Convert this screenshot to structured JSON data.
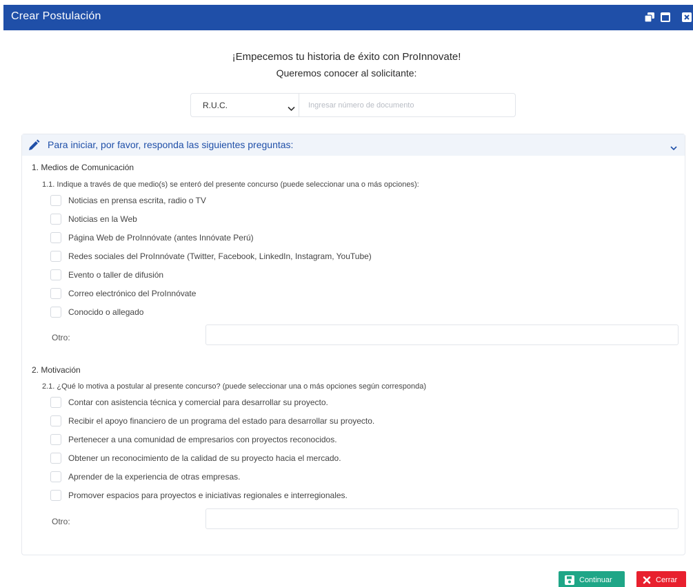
{
  "window": {
    "title": "Crear Postulación"
  },
  "intro": {
    "line1": "¡Empecemos tu historia de éxito con ProInnovate!",
    "line2": "Queremos conocer al solicitante:"
  },
  "document": {
    "type_selected": "R.U.C.",
    "number_value": "",
    "number_placeholder": "Ingresar número de documento"
  },
  "panel": {
    "title": "Para iniciar, por favor, responda las siguientes preguntas:",
    "sections": [
      {
        "title": "1. Medios de Comunicación",
        "question": "1.1. Indique a través de que medio(s) se enteró del presente concurso (puede seleccionar una o más opciones):",
        "options": [
          "Noticias en prensa escrita, radio o TV",
          "Noticias en la Web",
          "Página Web de ProInnóvate (antes Innóvate Perú)",
          "Redes sociales del ProInnóvate (Twitter, Facebook, LinkedIn, Instagram, YouTube)",
          "Evento o taller de difusión",
          "Correo electrónico del ProInnóvate",
          "Conocido o allegado"
        ],
        "other_label": "Otro:",
        "other_value": ""
      },
      {
        "title": "2. Motivación",
        "question": "2.1. ¿Qué lo motiva a postular al presente concurso? (puede seleccionar una o más opciones según corresponda)",
        "options": [
          "Contar con asistencia técnica y comercial para desarrollar su proyecto.",
          "Recibir el apoyo financiero de un programa del estado para desarrollar su proyecto.",
          "Pertenecer a una comunidad de empresarios con proyectos reconocidos.",
          "Obtener un reconocimiento de la calidad de su proyecto hacia el mercado.",
          "Aprender de la experiencia de otras empresas.",
          "Promover espacios para proyectos e iniciativas regionales e interregionales."
        ],
        "other_label": "Otro:",
        "other_value": ""
      }
    ]
  },
  "buttons": {
    "continue_label": "Continuar",
    "close_label": "Cerrar"
  },
  "colors": {
    "titlebar": "#1f4fa8",
    "accent": "#1f4fa8",
    "panel_header_bg": "#f0f4fa",
    "continue_button": "#1fa687",
    "close_button": "#e8202e"
  },
  "icons": {
    "restore": "restore-window-icon",
    "maximize": "maximize-window-icon",
    "close": "close-window-icon",
    "panel": "pencil-icon",
    "collapse": "chevron-down-icon",
    "continue": "save-icon",
    "close_button": "x-icon"
  }
}
